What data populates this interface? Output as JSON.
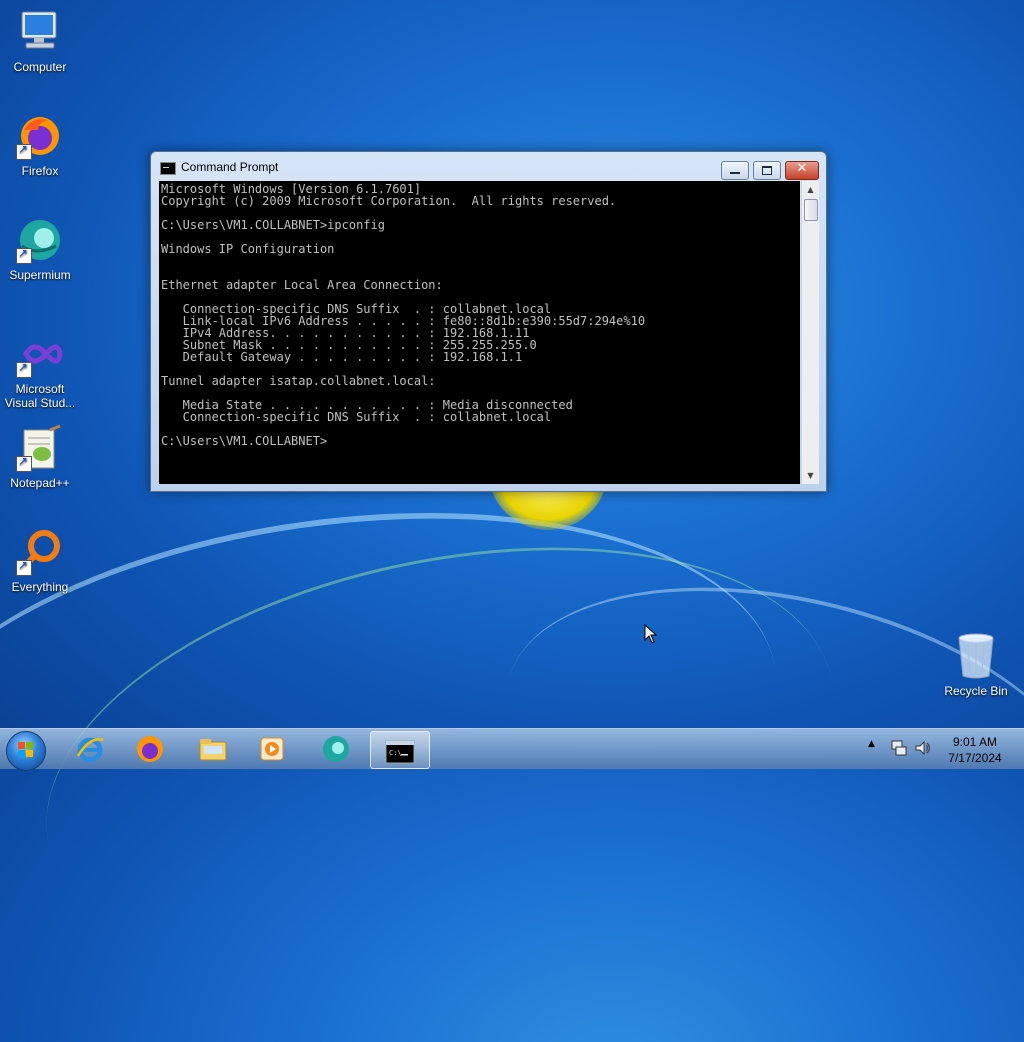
{
  "desktop": {
    "icons": [
      {
        "label": "Computer",
        "icon": "computer-icon"
      },
      {
        "label": "Firefox",
        "icon": "firefox-icon"
      },
      {
        "label": "Supermium",
        "icon": "supermium-icon"
      },
      {
        "label": "Microsoft Visual Stud...",
        "icon": "visual-studio-icon"
      },
      {
        "label": "Notepad++",
        "icon": "notepad-plus-plus-icon"
      },
      {
        "label": "Everything",
        "icon": "everything-icon"
      }
    ],
    "recycle_bin": {
      "label": "Recycle Bin",
      "icon": "recycle-bin-icon"
    }
  },
  "window": {
    "title": "Command Prompt",
    "console_lines": [
      "Microsoft Windows [Version 6.1.7601]",
      "Copyright (c) 2009 Microsoft Corporation.  All rights reserved.",
      "",
      "C:\\Users\\VM1.COLLABNET>ipconfig",
      "",
      "Windows IP Configuration",
      "",
      "",
      "Ethernet adapter Local Area Connection:",
      "",
      "   Connection-specific DNS Suffix  . : collabnet.local",
      "   Link-local IPv6 Address . . . . . : fe80::8d1b:e390:55d7:294e%10",
      "   IPv4 Address. . . . . . . . . . . : 192.168.1.11",
      "   Subnet Mask . . . . . . . . . . . : 255.255.255.0",
      "   Default Gateway . . . . . . . . . : 192.168.1.1",
      "",
      "Tunnel adapter isatap.collabnet.local:",
      "",
      "   Media State . . . . . . . . . . . : Media disconnected",
      "   Connection-specific DNS Suffix  . : collabnet.local",
      "",
      "C:\\Users\\VM1.COLLABNET>"
    ]
  },
  "taskbar": {
    "pinned": [
      "start-button",
      "internet-explorer-icon",
      "firefox-icon",
      "file-explorer-icon",
      "media-player-icon",
      "supermium-icon",
      "command-prompt-icon"
    ],
    "clock": {
      "time": "9:01 AM",
      "date": "7/17/2024"
    }
  },
  "colors": {
    "console_bg": "#000000",
    "console_fg": "#c0c0c0",
    "close_red": "#c3412a"
  }
}
